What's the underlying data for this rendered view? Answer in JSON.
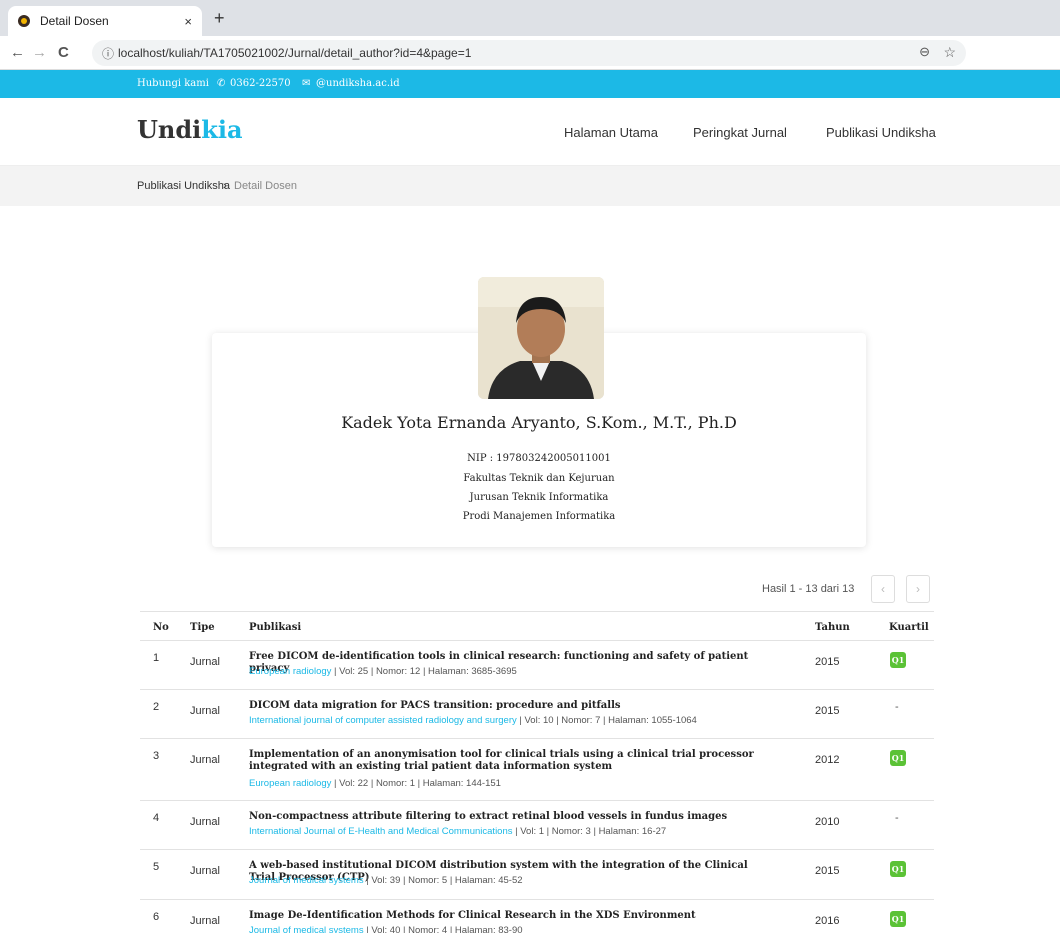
{
  "browser": {
    "tab_title": "Detail Dosen",
    "tab_close": "×",
    "new_tab": "+",
    "back": "←",
    "forward": "→",
    "reload": "C",
    "url": "localhost/kuliah/TA1705021002/Jurnal/detail_author?id=4&page=1"
  },
  "topbar": {
    "contact_label": "Hubungi kami",
    "phone": "0362-22570",
    "email": "@undiksha.ac.id"
  },
  "header": {
    "brand_main": "Undi",
    "brand_accent": "kia",
    "nav": [
      "Halaman Utama",
      "Peringkat Jurnal",
      "Publikasi Undiksha"
    ]
  },
  "breadcrumb": {
    "parent": "Publikasi Undiksha",
    "separator": "›",
    "current": "Detail Dosen"
  },
  "profile": {
    "name": "Kadek Yota Ernanda Aryanto, S.Kom., M.T., Ph.D",
    "nip": "NIP : 197803242005011001",
    "faculty": "Fakultas Teknik dan Kejuruan",
    "department": "Jurusan Teknik Informatika",
    "program": "Prodi Manajemen Informatika"
  },
  "pagination": {
    "results": "Hasil 1 - 13 dari 13",
    "prev": "‹",
    "next": "›"
  },
  "table": {
    "headers": {
      "no": "No",
      "type": "Tipe",
      "pub": "Publikasi",
      "year": "Tahun",
      "quartile": "Kuartil"
    },
    "rows": [
      {
        "no": "1",
        "type": "Jurnal",
        "title": "Free DICOM de-identification tools in clinical research: functioning and safety of patient privacy",
        "journal": "European radiology",
        "details": " | Vol: 25 | Nomor: 12 | Halaman: 3685-3695",
        "year": "2015",
        "quartile": "Q1"
      },
      {
        "no": "2",
        "type": "Jurnal",
        "title": "DICOM data migration for PACS transition: procedure and pitfalls",
        "journal": "International journal of computer assisted radiology and surgery",
        "details": " | Vol: 10 | Nomor: 7 | Halaman: 1055-1064",
        "year": "2015",
        "quartile": "-"
      },
      {
        "no": "3",
        "type": "Jurnal",
        "title": "Implementation of an anonymisation tool for clinical trials using a clinical trial processor integrated with an existing trial patient data information system",
        "journal": "European radiology",
        "details": " | Vol: 22 | Nomor: 1 | Halaman: 144-151",
        "year": "2012",
        "quartile": "Q1"
      },
      {
        "no": "4",
        "type": "Jurnal",
        "title": "Non-compactness attribute filtering to extract retinal blood vessels in fundus images",
        "journal": "International Journal of E-Health and Medical Communications",
        "details": " | Vol: 1 | Nomor: 3 | Halaman: 16-27",
        "year": "2010",
        "quartile": "-"
      },
      {
        "no": "5",
        "type": "Jurnal",
        "title": "A web-based institutional DICOM distribution system with the integration of the Clinical Trial Processor (CTP)",
        "journal": "Journal of medical systems",
        "details": " | Vol: 39 | Nomor: 5 | Halaman: 45-52",
        "year": "2015",
        "quartile": "Q1"
      },
      {
        "no": "6",
        "type": "Jurnal",
        "title": "Image De-Identification Methods for Clinical Research in the XDS Environment",
        "journal": "Journal of medical systems",
        "details": " | Vol: 40 | Nomor: 4 | Halaman: 83-90",
        "year": "2016",
        "quartile": "Q1"
      }
    ]
  },
  "colors": {
    "accent": "#1cb9e6",
    "q1_badge": "#5bc236"
  }
}
